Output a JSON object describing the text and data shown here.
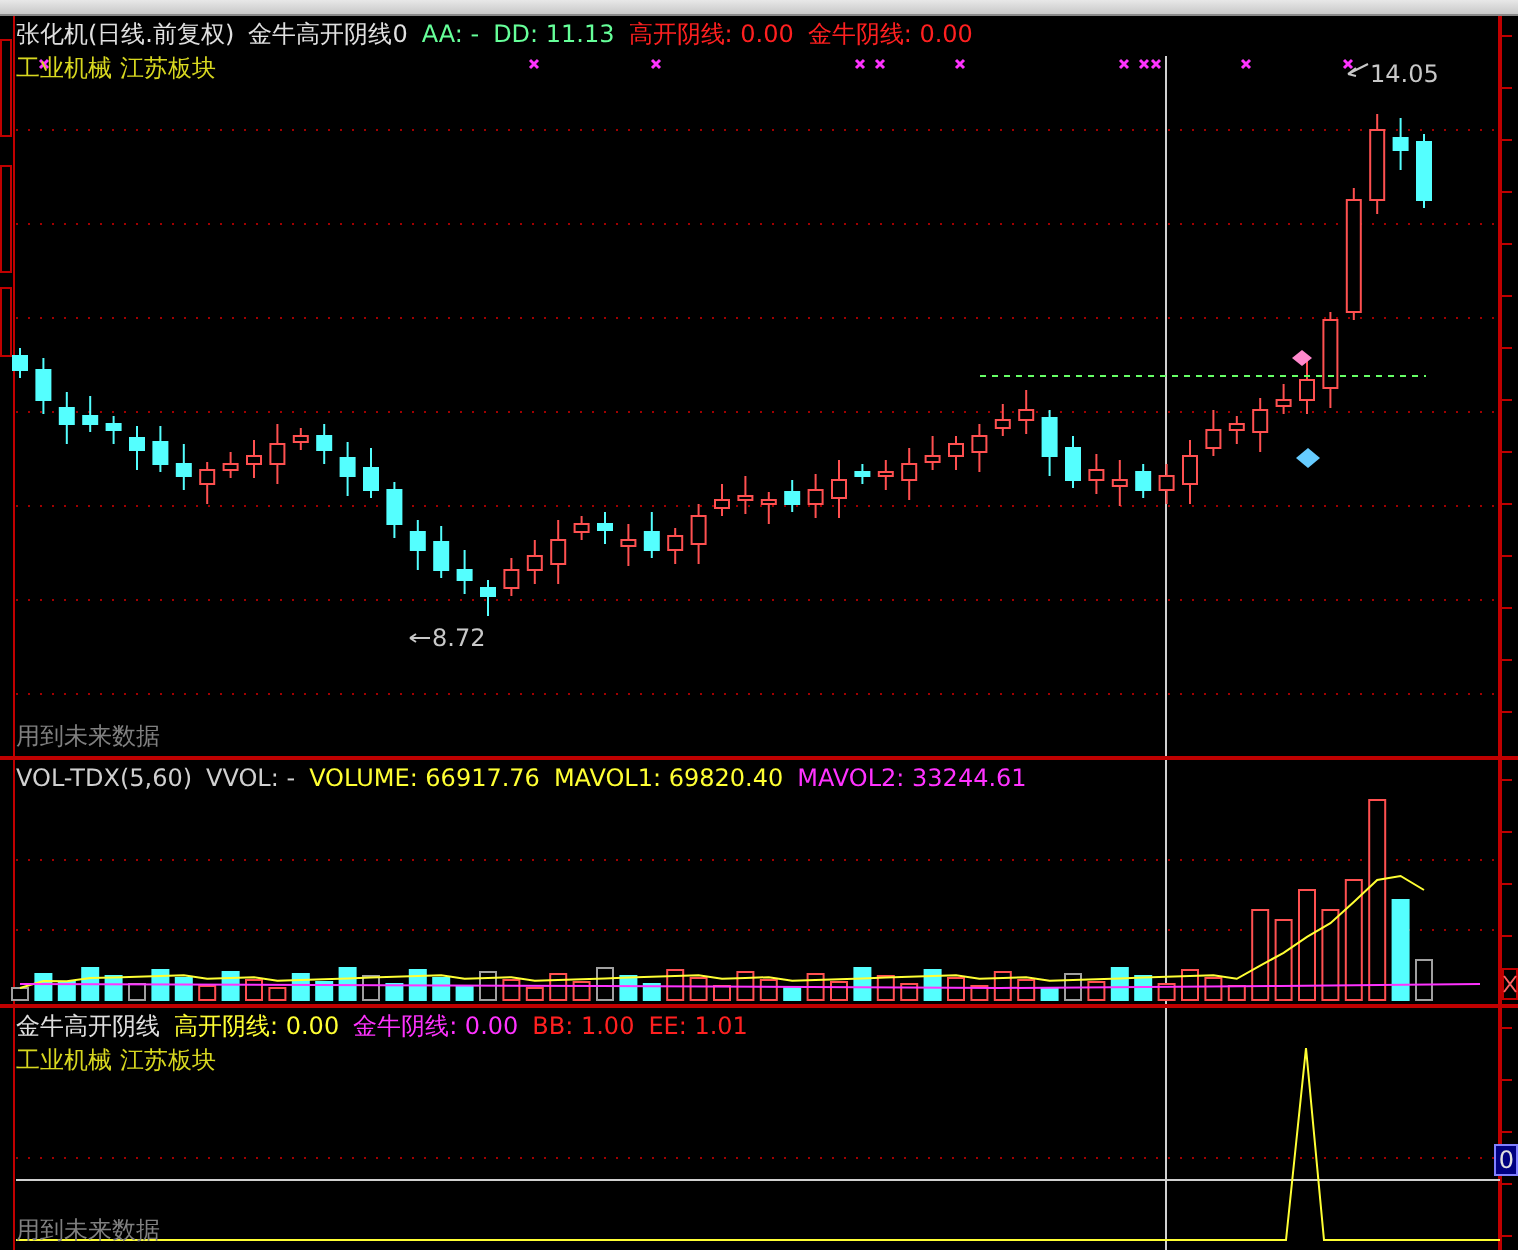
{
  "price_panel": {
    "header": [
      {
        "text": "张化机(日线.前复权)",
        "color": "#e0e0e0"
      },
      {
        "text": "金牛高开阴线0",
        "color": "#e0e0e0"
      },
      {
        "text": "AA: -",
        "color": "#66ff99"
      },
      {
        "text": "DD: 11.13",
        "color": "#66ff99"
      },
      {
        "text": "高开阴线: 0.00",
        "color": "#ff2020"
      },
      {
        "text": "金牛阴线: 0.00",
        "color": "#ff2020"
      }
    ],
    "sector": "工业机械 江苏板块",
    "high_label": "14.05",
    "low_label": "8.72",
    "note": "用到未来数据"
  },
  "volume_panel": {
    "header": [
      {
        "text": "VOL-TDX(5,60)",
        "color": "#d0d0d0"
      },
      {
        "text": "VVOL: -",
        "color": "#d0d0d0"
      },
      {
        "text": "VOLUME: 66917.76",
        "color": "#ffff33"
      },
      {
        "text": "MAVOL1: 69820.40",
        "color": "#ffff33"
      },
      {
        "text": "MAVOL2: 33244.61",
        "color": "#ff33ff"
      }
    ]
  },
  "indicator_panel": {
    "header": [
      {
        "text": "金牛高开阴线",
        "color": "#e0e0e0"
      },
      {
        "text": "高开阴线: 0.00",
        "color": "#ffff33"
      },
      {
        "text": "金牛阴线: 0.00",
        "color": "#ff33ff"
      },
      {
        "text": "BB: 1.00",
        "color": "#ff2020"
      },
      {
        "text": "EE: 1.01",
        "color": "#ff2020"
      }
    ],
    "sector": "工业机械 江苏板块",
    "note": "用到未来数据",
    "axis_value": "0"
  }
}
